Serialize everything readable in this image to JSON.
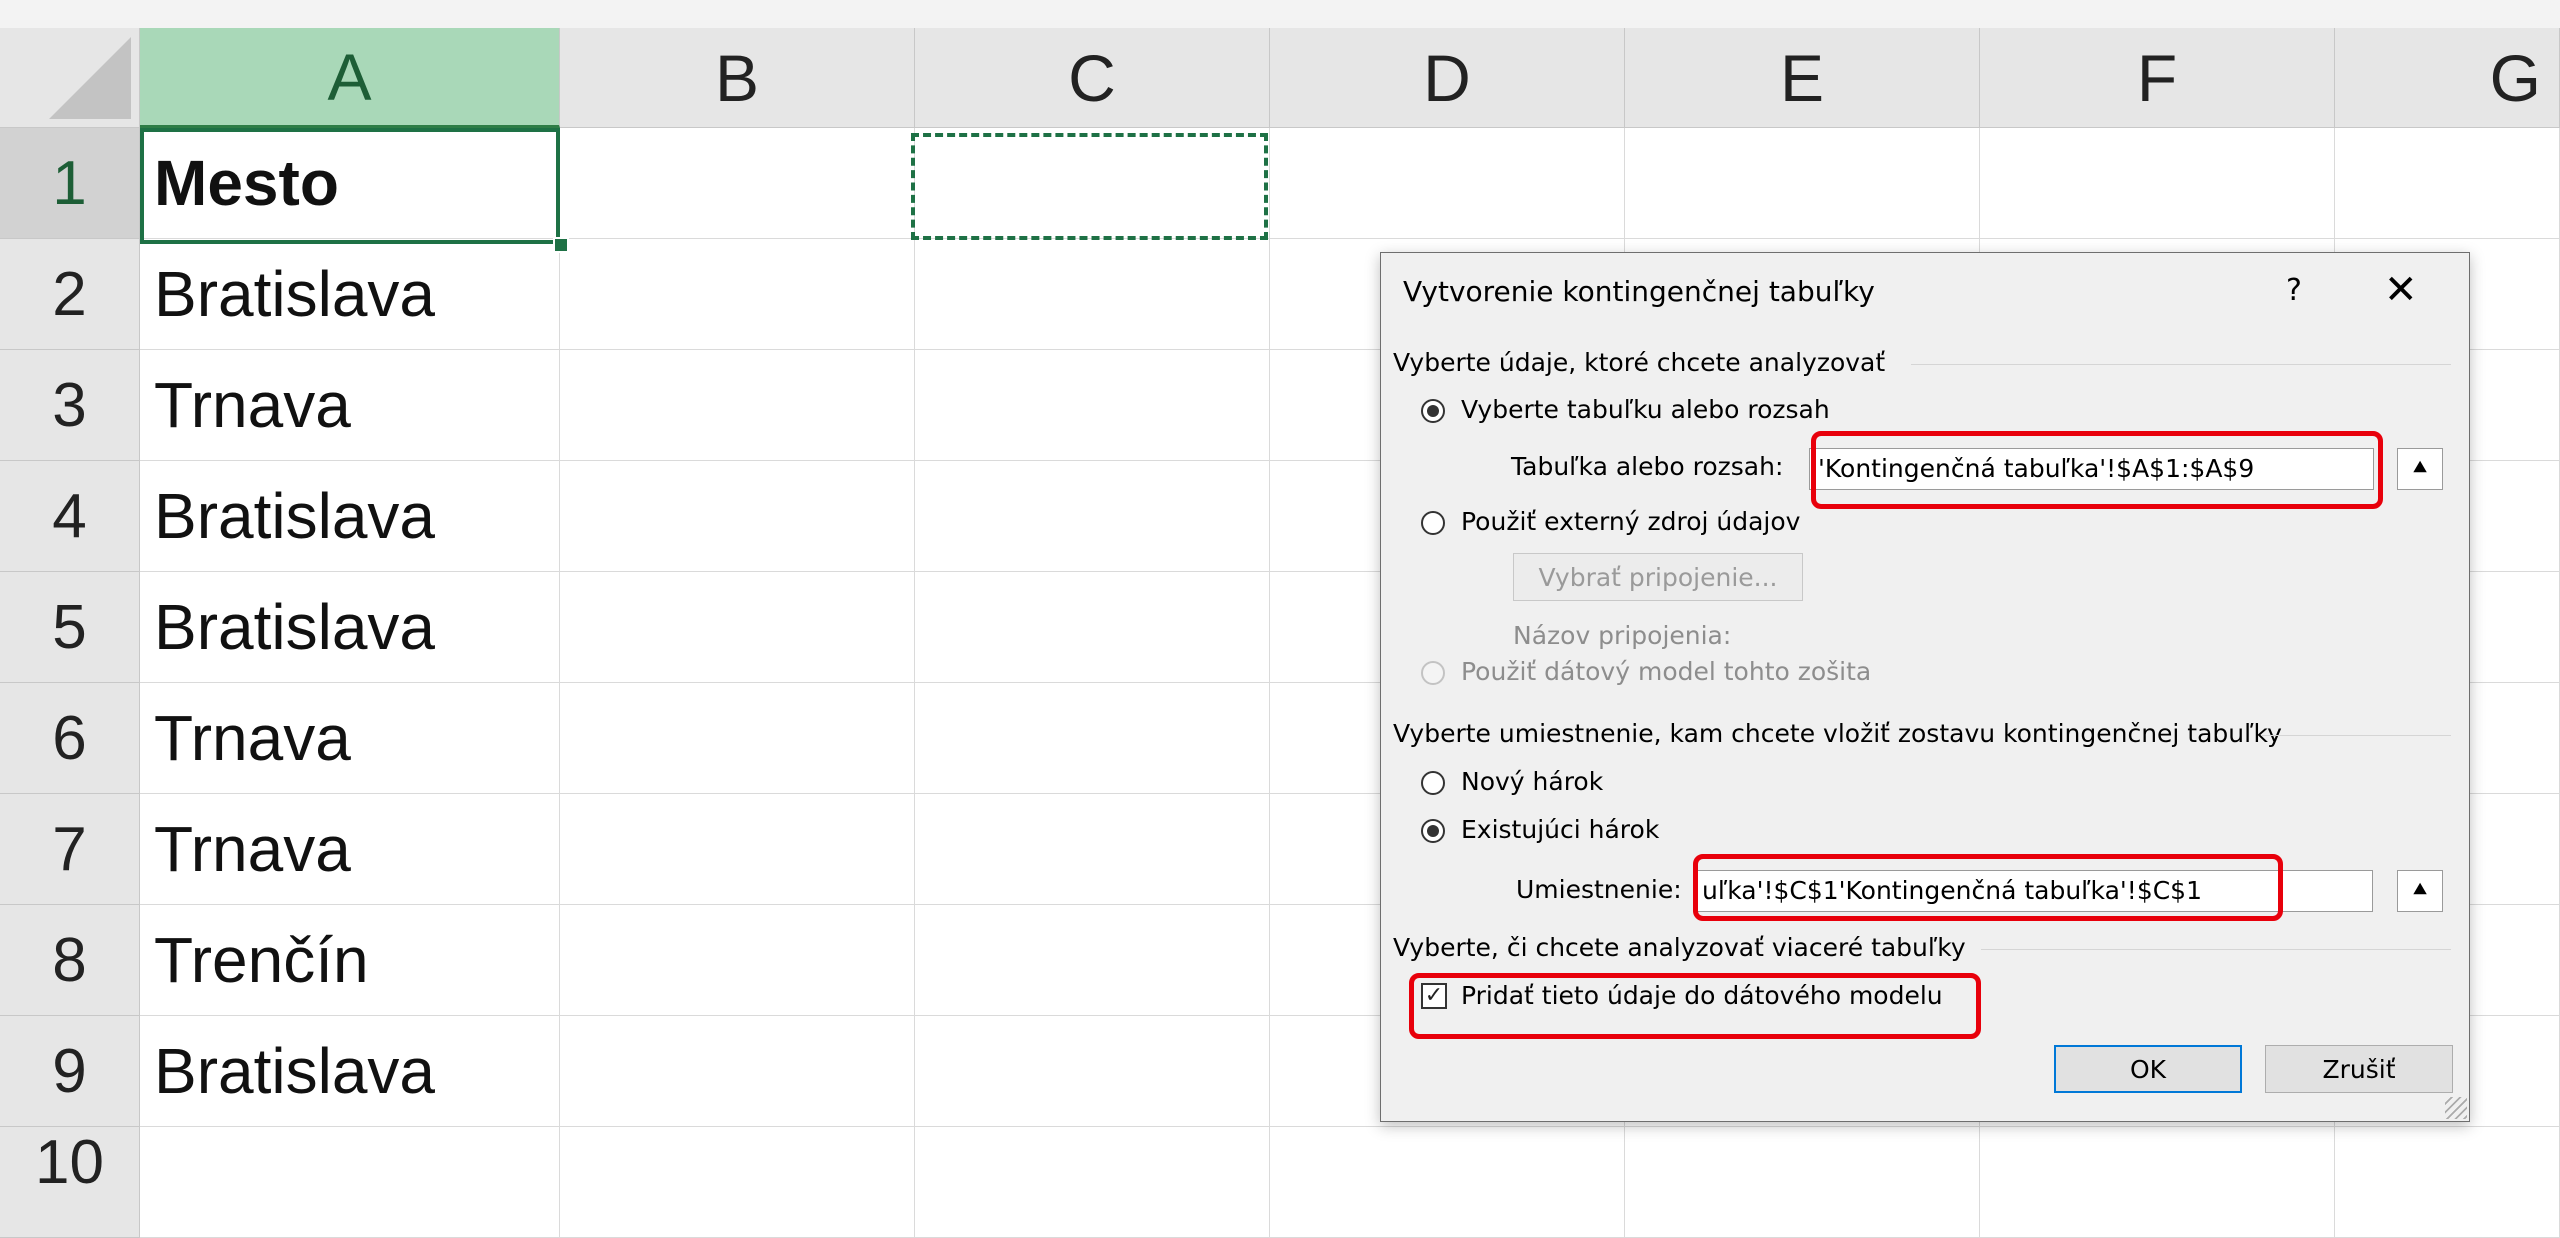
{
  "sheet": {
    "columns": [
      "A",
      "B",
      "C",
      "D",
      "E",
      "F",
      "G"
    ],
    "rows": [
      "1",
      "2",
      "3",
      "4",
      "5",
      "6",
      "7",
      "8",
      "9",
      "10"
    ],
    "cells_A": [
      "Mesto",
      "Bratislava",
      "Trnava",
      "Bratislava",
      "Bratislava",
      "Trnava",
      "Trnava",
      "Trenčín",
      "Bratislava"
    ],
    "active_cell": "A1",
    "copy_range": "C1"
  },
  "dialog": {
    "title": "Vytvorenie kontingenčnej tabuľky",
    "help": "?",
    "close": "✕",
    "section1": "Vyberte údaje, ktoré chcete analyzovať",
    "radio_table": "Vyberte tabuľku alebo rozsah",
    "label_range": "Tabuľka alebo rozsah:",
    "range_value": "'Kontingenčná tabuľka'!$A$1:$A$9",
    "radio_external": "Použiť externý zdroj údajov",
    "btn_choose_connection": "Vybrať pripojenie...",
    "label_connection_name": "Názov pripojenia:",
    "radio_datamodel": "Použiť dátový model tohto zošita",
    "section2": "Vyberte umiestnenie, kam chcete vložiť zostavu kontingenčnej tabuľky",
    "radio_new_sheet": "Nový hárok",
    "radio_existing_sheet": "Existujúci hárok",
    "label_location": "Umiestnenie:",
    "location_value": "uľka'!$C$1'Kontingenčná tabuľka'!$C$1",
    "section3": "Vyberte, či chcete analyzovať viaceré tabuľky",
    "checkbox_add_model": "Pridať tieto údaje do dátového modelu",
    "btn_ok": "OK",
    "btn_cancel": "Zrušiť",
    "collapse_icon": "⯅"
  },
  "colors": {
    "selection_green": "#1e7145",
    "highlight_red": "#e8000b"
  }
}
